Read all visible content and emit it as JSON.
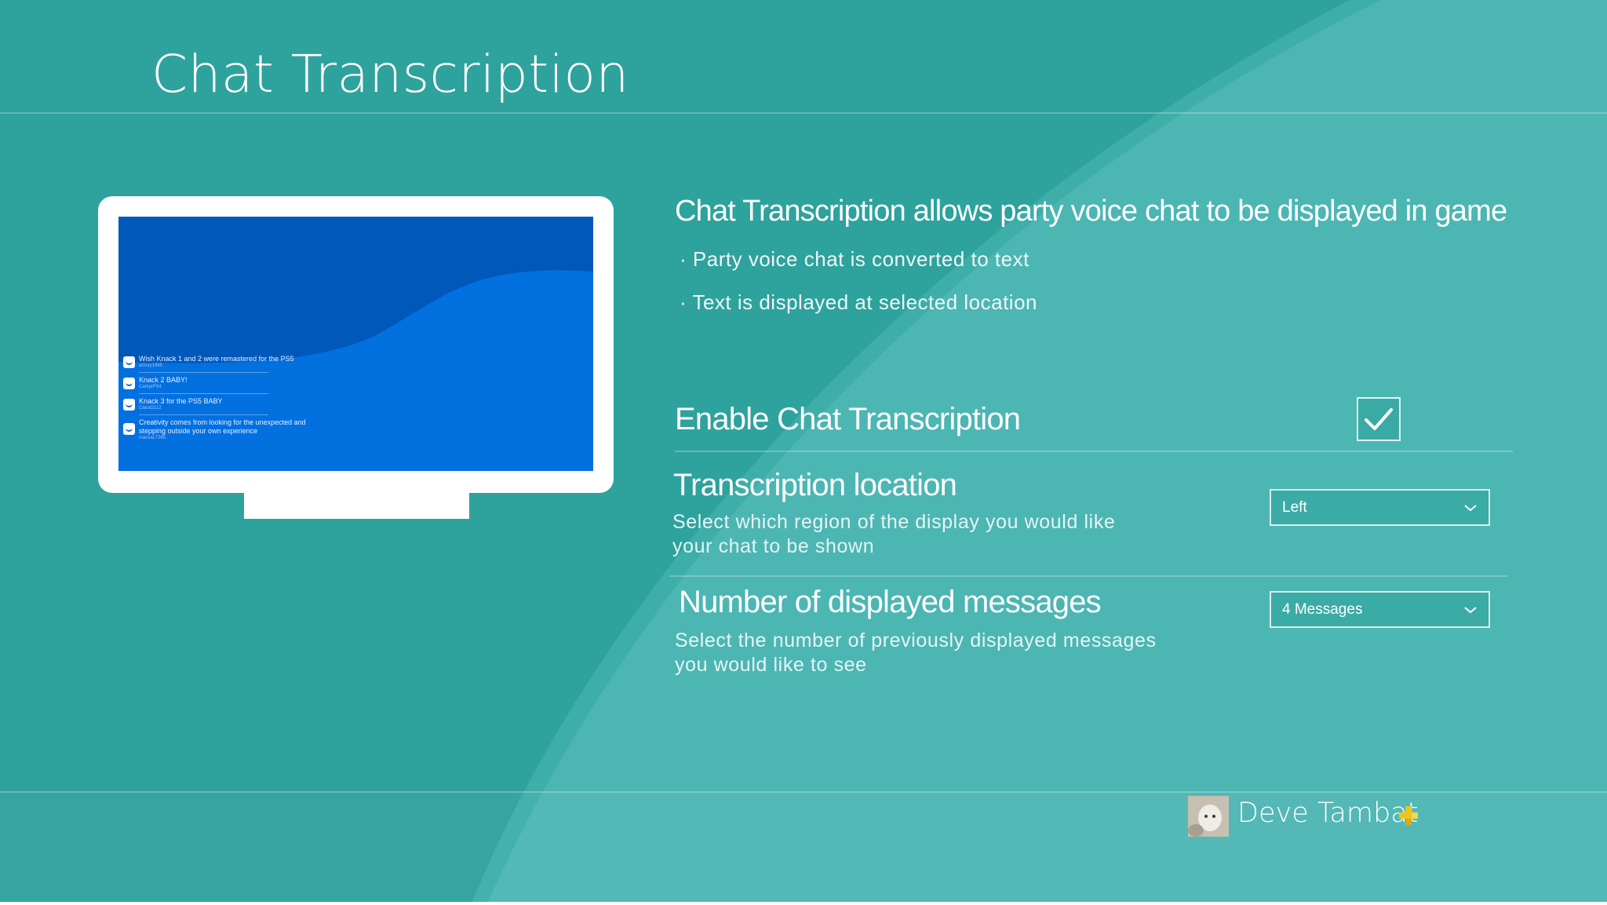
{
  "page": {
    "title": "Chat Transcription"
  },
  "preview": {
    "messages": [
      {
        "text": "Wish Knack 1 and 2 were remastered for the PS5",
        "user": "amory1985"
      },
      {
        "text": "Knack 2 BABY!",
        "user": "CampiPS4"
      },
      {
        "text": "Knack 3 for the PS5 BABY",
        "user": "ClaraG112"
      },
      {
        "text": "Creativity comes from looking for the unexpected and stepping outside your own experience",
        "user": "massaLT365"
      }
    ]
  },
  "description": {
    "title": "Chat Transcription allows party voice chat to be displayed in game",
    "bullets": [
      "Party voice chat is converted to text",
      "Text is displayed at selected location"
    ]
  },
  "settings": {
    "enable": {
      "label": "Enable Chat Transcription",
      "checked": true
    },
    "location": {
      "label": "Transcription location",
      "description_line1": "Select which region of the display you would like",
      "description_line2": "your chat to be shown",
      "value": "Left"
    },
    "messages": {
      "label": "Number of displayed messages",
      "description_line1": "Select the number of previously displayed messages",
      "description_line2": "you would like to see",
      "value": "4 Messages"
    }
  },
  "user": {
    "name": "Deve Tambat"
  },
  "colors": {
    "background": "#2ea29c",
    "tv_screen": "#0058bb",
    "plus_badge": "#f2c318"
  },
  "icons": {
    "checkbox": "checkmark-icon",
    "dropdown": "chevron-down-icon",
    "membership": "playstation-plus-icon"
  }
}
